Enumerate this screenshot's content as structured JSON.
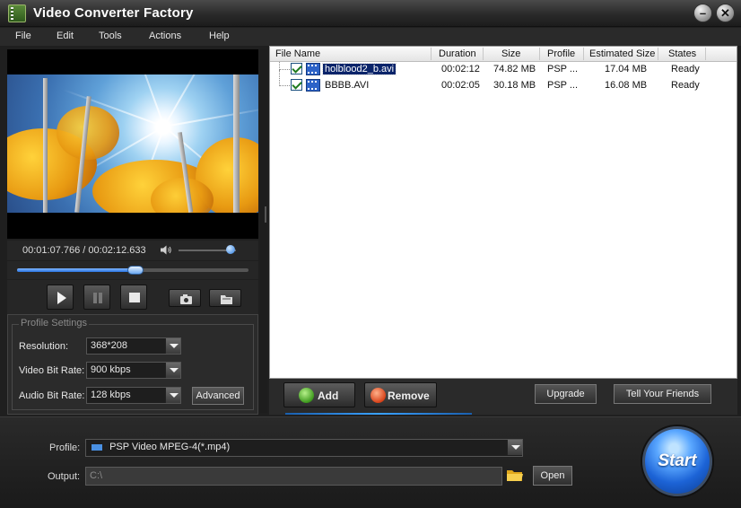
{
  "app": {
    "title": "Video Converter Factory"
  },
  "window_controls": {
    "minimize": "–",
    "close": "✕"
  },
  "menu": [
    "File",
    "Edit",
    "Tools",
    "Actions",
    "Help"
  ],
  "player": {
    "time_display": "00:01:07.766 / 00:02:12.633",
    "progress": 0.512,
    "volume": 0.9
  },
  "profile_settings": {
    "legend": "Profile Settings",
    "resolution": {
      "label": "Resolution:",
      "value": "368*208"
    },
    "video_bit_rate": {
      "label": "Video Bit Rate:",
      "value": "900 kbps"
    },
    "audio_bit_rate": {
      "label": "Audio Bit Rate:",
      "value": "128 kbps"
    },
    "advanced_label": "Advanced"
  },
  "file_list": {
    "columns": [
      "File Name",
      "Duration",
      "Size",
      "Profile",
      "Estimated Size",
      "States"
    ],
    "rows": [
      {
        "name": "holblood2_b.avi",
        "duration": "00:02:12",
        "size": "74.82 MB",
        "profile": "PSP ...",
        "estimated": "17.04 MB",
        "state": "Ready",
        "checked": true,
        "selected": true
      },
      {
        "name": "BBBB.AVI",
        "duration": "00:02:05",
        "size": "30.18 MB",
        "profile": "PSP ...",
        "estimated": "16.08 MB",
        "state": "Ready",
        "checked": true,
        "selected": false
      }
    ]
  },
  "list_buttons": {
    "add": "Add",
    "remove": "Remove",
    "upgrade": "Upgrade",
    "tell_friends": "Tell Your Friends"
  },
  "output": {
    "profile_label": "Profile:",
    "profile_value": "PSP Video MPEG-4(*.mp4)",
    "output_label": "Output:",
    "output_value": "C:\\",
    "open_label": "Open",
    "start_label": "Start"
  }
}
